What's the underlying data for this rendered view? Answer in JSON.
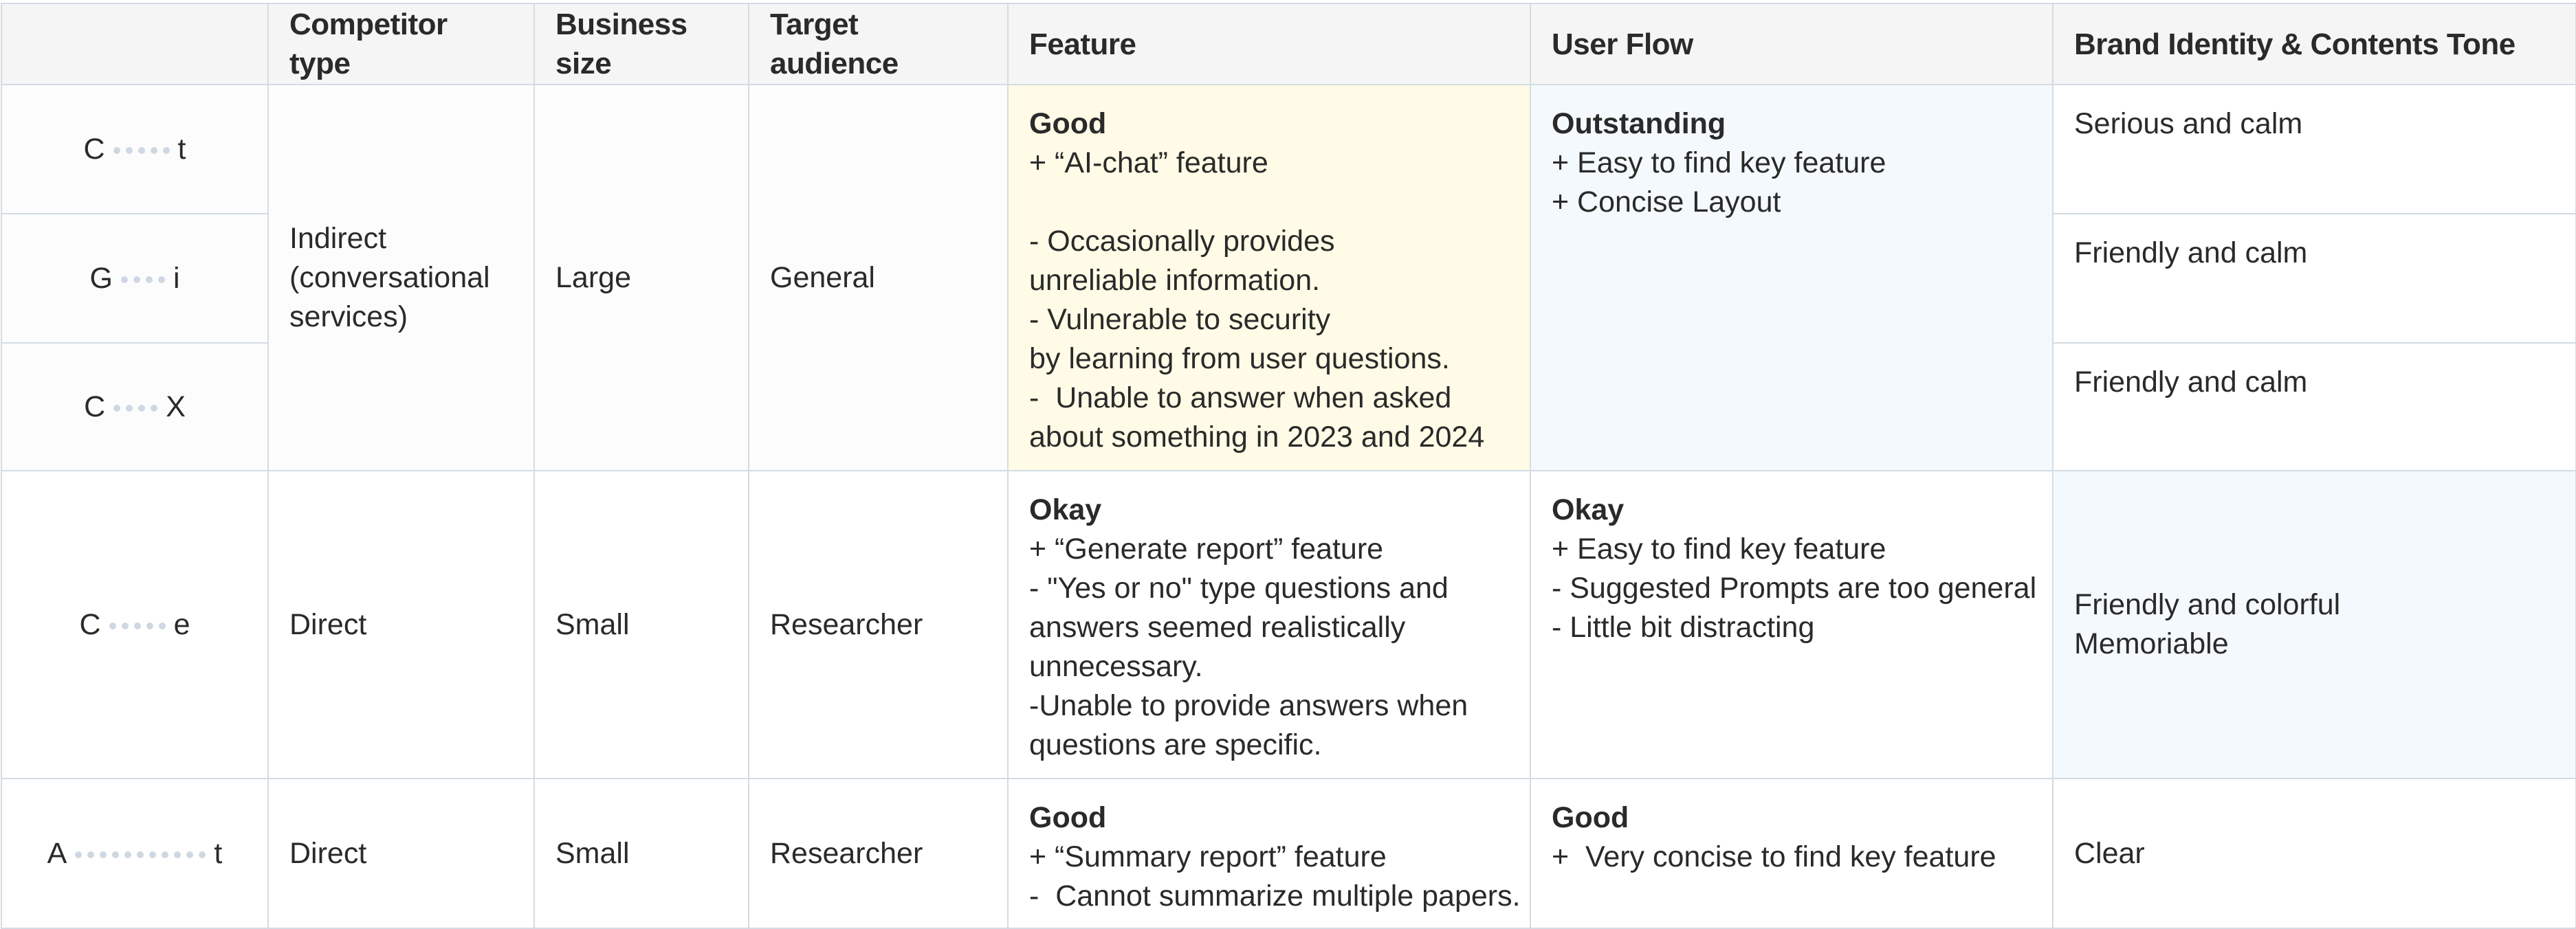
{
  "headers": {
    "blank": "",
    "competitor_type": "Competitor type",
    "business_size": "Business size",
    "target_audience": "Target audience",
    "feature": "Feature",
    "user_flow": "User Flow",
    "brand": "Brand Identity & Contents Tone"
  },
  "group1": {
    "names": [
      {
        "first": "C",
        "last": "t",
        "dots": 5
      },
      {
        "first": "G",
        "last": "i",
        "dots": 4
      },
      {
        "first": "C",
        "last": "X",
        "dots": 4
      }
    ],
    "competitor_type": [
      "Indirect",
      "(conversational",
      "services)"
    ],
    "business_size": "Large",
    "target_audience": "General",
    "feature": {
      "rating": "Good",
      "lines_a": [
        "+ “AI-chat” feature"
      ],
      "lines_b": [
        "- Occasionally provides",
        "unreliable information.",
        "- Vulnerable to security",
        "by learning from user questions.",
        "-  Unable to answer when asked",
        "about something in 2023 and 2024"
      ]
    },
    "user_flow": {
      "rating": "Outstanding",
      "lines": [
        "+ Easy to find key feature",
        "+ Concise Layout"
      ]
    },
    "brand": [
      "Serious and calm",
      "Friendly and calm",
      "Friendly and  calm"
    ]
  },
  "group2": {
    "name": {
      "first": "C",
      "last": "e",
      "dots": 5
    },
    "competitor_type": "Direct",
    "business_size": "Small",
    "target_audience": "Researcher",
    "feature": {
      "rating": "Okay",
      "lines": [
        "+ “Generate report” feature",
        "- \"Yes or no\" type questions and",
        "answers seemed realistically",
        "unnecessary.",
        "-Unable to provide answers when",
        "questions are specific."
      ]
    },
    "user_flow": {
      "rating": "Okay",
      "lines": [
        "+ Easy to find key feature",
        "- Suggested Prompts are too general",
        "- Little bit distracting"
      ]
    },
    "brand": [
      "Friendly and colorful",
      "Memoriable"
    ]
  },
  "group3": {
    "name": {
      "first": "A",
      "last": "t",
      "dots": 11
    },
    "competitor_type": "Direct",
    "business_size": "Small",
    "target_audience": "Researcher",
    "feature": {
      "rating": "Good",
      "lines": [
        "+ “Summary report” feature",
        "-  Cannot summarize multiple papers."
      ]
    },
    "user_flow": {
      "rating": "Good",
      "lines": [
        "+  Very concise to find key feature"
      ]
    },
    "brand": "Clear"
  },
  "colors": {
    "border": "#d3dbe3",
    "header_bg": "#f5f5f5",
    "feature_highlight": "#fffbe6",
    "flow_highlight": "#f4f9fd",
    "redaction_dot": "#cfd8e2"
  }
}
